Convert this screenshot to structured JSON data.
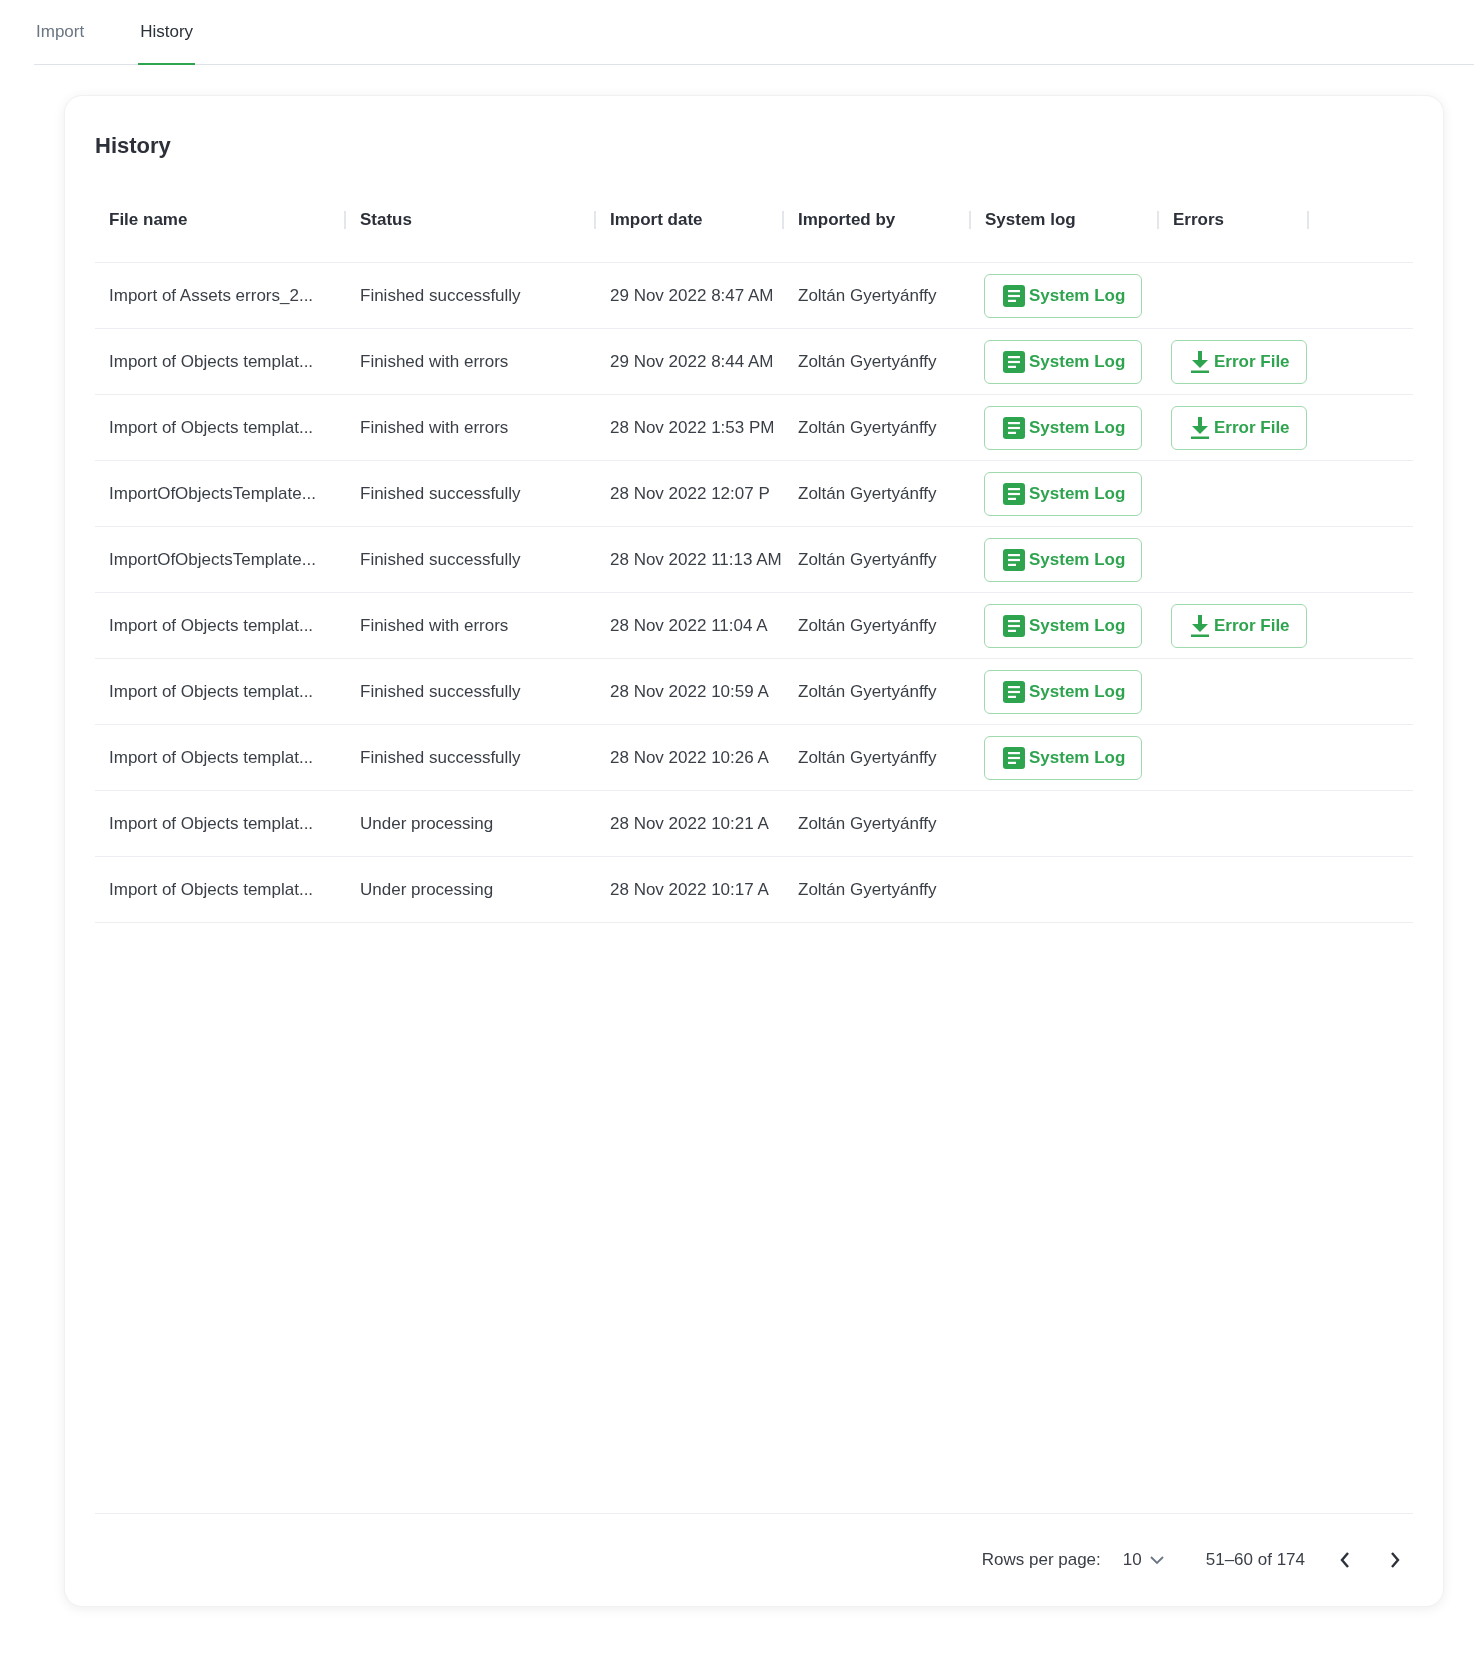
{
  "tabs": [
    {
      "label": "Import",
      "selected": false
    },
    {
      "label": "History",
      "selected": true
    }
  ],
  "card": {
    "title": "History",
    "table": {
      "columns": [
        "File name",
        "Status",
        "Import date",
        "Imported by",
        "System log",
        "Errors"
      ],
      "rows": [
        {
          "file_name": "Import of Assets errors_2...",
          "status": "Finished successfully",
          "import_date": "29 Nov 2022 8:47 AM",
          "imported_by": "Zoltán Gyertyánffy",
          "system_log": "System Log"
        },
        {
          "file_name": "Import of Objects templat...",
          "status": "Finished with errors",
          "import_date": "29 Nov 2022 8:44 AM",
          "imported_by": "Zoltán Gyertyánffy",
          "system_log": "System Log",
          "error_file": "Error File"
        },
        {
          "file_name": "Import of Objects templat...",
          "status": "Finished with errors",
          "import_date": "28 Nov 2022 1:53 PM",
          "imported_by": "Zoltán Gyertyánffy",
          "system_log": "System Log",
          "error_file": "Error File"
        },
        {
          "file_name": "ImportOfObjectsTemplate...",
          "status": "Finished successfully",
          "import_date": "28 Nov 2022 12:07 P",
          "imported_by": "Zoltán Gyertyánffy",
          "system_log": "System Log"
        },
        {
          "file_name": "ImportOfObjectsTemplate...",
          "status": "Finished successfully",
          "import_date": "28 Nov 2022 11:13 AM",
          "imported_by": "Zoltán Gyertyánffy",
          "system_log": "System Log"
        },
        {
          "file_name": "Import of Objects templat...",
          "status": "Finished with errors",
          "import_date": "28 Nov 2022 11:04 A",
          "imported_by": "Zoltán Gyertyánffy",
          "system_log": "System Log",
          "error_file": "Error File"
        },
        {
          "file_name": "Import of Objects templat...",
          "status": "Finished successfully",
          "import_date": "28 Nov 2022 10:59 A",
          "imported_by": "Zoltán Gyertyánffy",
          "system_log": "System Log"
        },
        {
          "file_name": "Import of Objects templat...",
          "status": "Finished successfully",
          "import_date": "28 Nov 2022 10:26 A",
          "imported_by": "Zoltán Gyertyánffy",
          "system_log": "System Log"
        },
        {
          "file_name": "Import of Objects templat...",
          "status": "Under processing",
          "import_date": "28 Nov 2022 10:21 A",
          "imported_by": "Zoltán Gyertyánffy"
        },
        {
          "file_name": "Import of Objects templat...",
          "status": "Under processing",
          "import_date": "28 Nov 2022 10:17 A",
          "imported_by": "Zoltán Gyertyánffy"
        }
      ]
    },
    "pagination": {
      "rows_per_page_label": "Rows per page:",
      "rows_per_page": "10",
      "range": "51–60 of 174"
    }
  }
}
